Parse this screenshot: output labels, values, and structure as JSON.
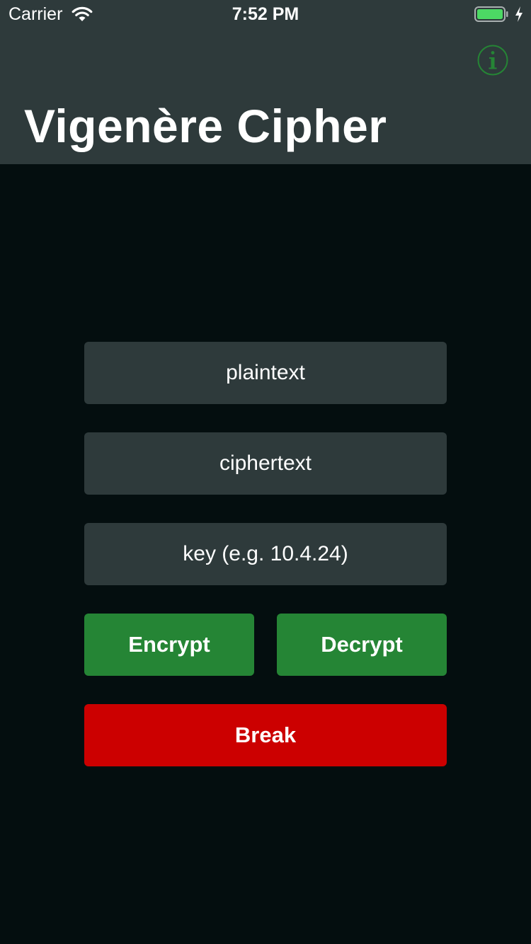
{
  "status_bar": {
    "carrier": "Carrier",
    "time": "7:52 PM",
    "icons": [
      "wifi-icon",
      "battery-icon",
      "charging-bolt-icon"
    ],
    "battery_level": 1.0
  },
  "navbar": {
    "title": "Vigenère Cipher",
    "info_icon": "info-circle-icon"
  },
  "form": {
    "plaintext_placeholder": "plaintext",
    "ciphertext_placeholder": "ciphertext",
    "key_placeholder": "key (e.g. 10.4.24)",
    "plaintext_value": "",
    "ciphertext_value": "",
    "key_value": ""
  },
  "actions": {
    "encrypt_label": "Encrypt",
    "decrypt_label": "Decrypt",
    "break_label": "Break"
  },
  "colors": {
    "navbar_bg": "#2e3a3b",
    "page_bg": "#040e0f",
    "field_bg": "#2e3a3b",
    "encrypt_bg": "#258535",
    "decrypt_bg": "#258535",
    "break_bg": "#cc0000",
    "info_icon": "#258535",
    "battery_fill": "#4cd964"
  }
}
